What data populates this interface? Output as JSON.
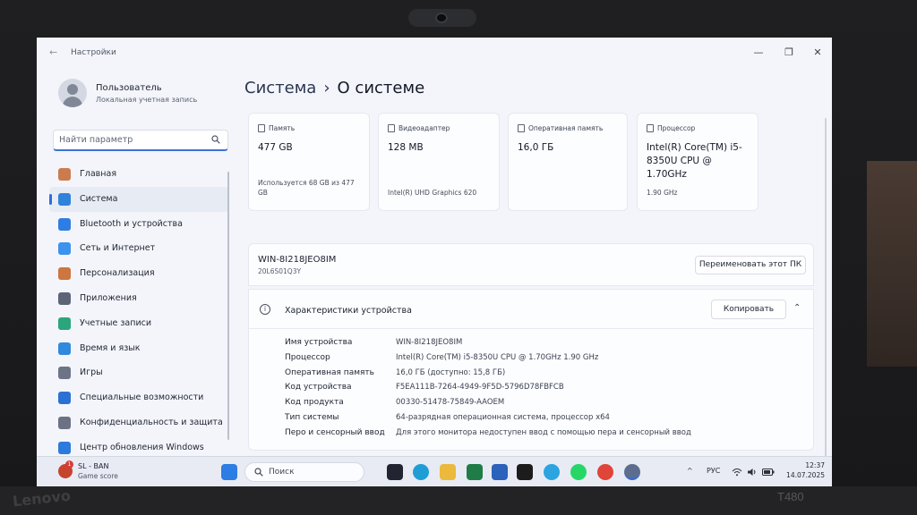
{
  "window": {
    "title": "Настройки",
    "back_glyph": "←",
    "minimize_glyph": "—",
    "restore_glyph": "❐",
    "close_glyph": "✕"
  },
  "user": {
    "name": "Пользователь",
    "account_type": "Локальная учетная запись"
  },
  "search": {
    "placeholder": "Найти параметр"
  },
  "sidebar": {
    "items": [
      {
        "label": "Главная",
        "icon": "home-icon",
        "color": "#c77a4d"
      },
      {
        "label": "Система",
        "icon": "system-icon",
        "color": "#2f7fd6",
        "active": true
      },
      {
        "label": "Bluetooth и устройства",
        "icon": "bluetooth-icon",
        "color": "#2d7be0"
      },
      {
        "label": "Сеть и Интернет",
        "icon": "network-icon",
        "color": "#3c8fe6"
      },
      {
        "label": "Персонализация",
        "icon": "brush-icon",
        "color": "#c9743e"
      },
      {
        "label": "Приложения",
        "icon": "apps-icon",
        "color": "#5a6274"
      },
      {
        "label": "Учетные записи",
        "icon": "accounts-icon",
        "color": "#2aa27a"
      },
      {
        "label": "Время и язык",
        "icon": "globe-icon",
        "color": "#2f86d8"
      },
      {
        "label": "Игры",
        "icon": "gamepad-icon",
        "color": "#6b7282"
      },
      {
        "label": "Специальные возможности",
        "icon": "accessibility-icon",
        "color": "#2a6fd0"
      },
      {
        "label": "Конфиденциальность и защита",
        "icon": "shield-icon",
        "color": "#6a7080"
      },
      {
        "label": "Центр обновления Windows",
        "icon": "update-icon",
        "color": "#2a78d8"
      }
    ]
  },
  "breadcrumb": {
    "parent": "Система",
    "separator": "›",
    "current": "О системе"
  },
  "cards": [
    {
      "title": "Память",
      "icon": "storage-icon",
      "value": "477 GB",
      "sub": "Используется 68 GB из 477 GB"
    },
    {
      "title": "Видеоадаптер",
      "icon": "gpu-icon",
      "value": "128 MB",
      "sub": "Intel(R) UHD Graphics 620"
    },
    {
      "title": "Оперативная память",
      "icon": "ram-icon",
      "value": "16,0 ГБ",
      "sub": ""
    },
    {
      "title": "Процессор",
      "icon": "cpu-icon",
      "value": "Intel(R) Core(TM) i5-8350U CPU @ 1.70GHz",
      "sub": "1.90 GHz"
    }
  ],
  "device": {
    "name": "WIN-8I218JEO8IM",
    "model": "20L6S01Q3Y",
    "rename_label": "Переименовать этот ПК"
  },
  "specs": {
    "title": "Характеристики устройства",
    "copy_label": "Копировать",
    "collapse_glyph": "⌃",
    "rows": [
      {
        "key": "Имя устройства",
        "value": "WIN-8I218JEO8IM"
      },
      {
        "key": "Процессор",
        "value": "Intel(R) Core(TM) i5-8350U CPU @ 1.70GHz   1.90 GHz"
      },
      {
        "key": "Оперативная память",
        "value": "16,0 ГБ (доступно: 15,8 ГБ)"
      },
      {
        "key": "Код устройства",
        "value": "F5EA111B-7264-4949-9F5D-5796D78FBFCB"
      },
      {
        "key": "Код продукта",
        "value": "00330-51478-75849-AAOEM"
      },
      {
        "key": "Тип системы",
        "value": "64-разрядная операционная система, процессор x64"
      },
      {
        "key": "Перо и сенсорный ввод",
        "value": "Для этого монитора недоступен ввод с помощью пера и сенсорный ввод"
      }
    ]
  },
  "taskbar": {
    "weather_line1": "SL - BAN",
    "weather_line2": "Game score",
    "weather_badge": "1",
    "search_label": "Поиск",
    "apps": [
      {
        "icon": "windows-start-icon",
        "color": "#2b7be0"
      },
      {
        "icon": "task-view-icon",
        "color": "#1f2430"
      },
      {
        "icon": "edge-icon",
        "color": "#1d9bd1"
      },
      {
        "icon": "file-explorer-icon",
        "color": "#e7b53c"
      },
      {
        "icon": "excel-icon",
        "color": "#1f7a45"
      },
      {
        "icon": "word-icon",
        "color": "#2b5fb8"
      },
      {
        "icon": "capcut-icon",
        "color": "#1b1b1b"
      },
      {
        "icon": "telegram-icon",
        "color": "#2aa1dc"
      },
      {
        "icon": "whatsapp-icon",
        "color": "#25d366"
      },
      {
        "icon": "chrome-icon",
        "color": "#db4437"
      },
      {
        "icon": "settings-icon",
        "color": "#5b6b8c"
      }
    ],
    "tray_chevron": "^",
    "language": "РУС",
    "time": "12:37",
    "date": "14.07.2025"
  },
  "hardware": {
    "brand": "Lenovo",
    "model": "T480"
  }
}
